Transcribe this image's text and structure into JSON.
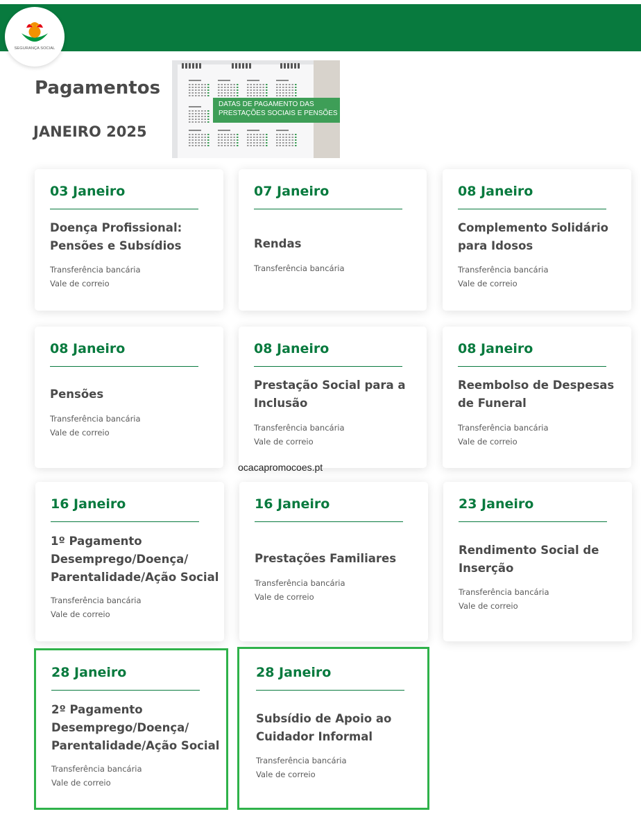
{
  "brand": {
    "name": "SEGURANÇA SOCIAL",
    "colors": {
      "primary": "#087a3e",
      "highlight": "#2fb24a",
      "logo_orange": "#f39200",
      "logo_green": "#009640",
      "logo_red": "#e30613"
    }
  },
  "page": {
    "title": "Pagamentos",
    "subtitle": "JANEIRO 2025"
  },
  "banner": {
    "lines": [
      "DATAS DE PAGAMENTO DAS",
      "PRESTAÇÕES SOCIAIS E PENSÕES"
    ]
  },
  "cards": [
    {
      "date": "03 Janeiro",
      "titles": [
        "Doença Profissional:",
        "Pensões e Subsídios"
      ],
      "methods": [
        "Transferência bancária",
        "Vale de correio"
      ]
    },
    {
      "date": "07 Janeiro",
      "titles": [
        "Rendas"
      ],
      "methods": [
        "Transferência bancária"
      ]
    },
    {
      "date": "08 Janeiro",
      "titles": [
        "Complemento Solidário",
        "para Idosos"
      ],
      "methods": [
        "Transferência bancária",
        "Vale de correio"
      ]
    },
    {
      "date": "08 Janeiro",
      "titles": [
        "Pensões"
      ],
      "methods": [
        "Transferência bancária",
        "Vale de correio"
      ]
    },
    {
      "date": "08 Janeiro",
      "titles": [
        "Prestação Social para a",
        "Inclusão"
      ],
      "methods": [
        "Transferência bancária",
        "Vale de correio"
      ]
    },
    {
      "date": "08 Janeiro",
      "titles": [
        "Reembolso de Despesas",
        "de Funeral"
      ],
      "methods": [
        "Transferência bancária",
        "Vale de correio"
      ]
    },
    {
      "date": "16 Janeiro",
      "titles": [
        "1º Pagamento",
        "Desemprego/Doença/",
        "Parentalidade/Ação Social"
      ],
      "methods": [
        "Transferência bancária",
        "Vale de correio"
      ]
    },
    {
      "date": "16 Janeiro",
      "titles": [
        "Prestações Familiares"
      ],
      "methods": [
        "Transferência bancária",
        "Vale de correio"
      ]
    },
    {
      "date": "23 Janeiro",
      "titles": [
        "Rendimento Social de",
        "Inserção"
      ],
      "methods": [
        "Transferência bancária",
        "Vale de correio"
      ]
    },
    {
      "date": "28 Janeiro",
      "titles": [
        "2º Pagamento",
        "Desemprego/Doença/",
        "Parentalidade/Ação Social"
      ],
      "methods": [
        "Transferência bancária",
        "Vale de correio"
      ]
    },
    {
      "date": "28 Janeiro",
      "titles": [
        "Subsídio de Apoio ao",
        "Cuidador Informal"
      ],
      "methods": [
        "Transferência bancária",
        "Vale de correio"
      ]
    }
  ],
  "watermark": "ocacapromocoes.pt"
}
